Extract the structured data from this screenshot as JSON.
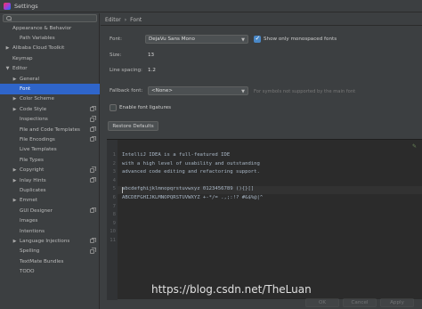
{
  "window": {
    "title": "Settings"
  },
  "sidebar": {
    "search_placeholder": "",
    "items": [
      {
        "label": "Appearance & Behavior",
        "indent": 0,
        "arrow": "",
        "selected": false,
        "copy": false
      },
      {
        "label": "Path Variables",
        "indent": 1,
        "arrow": "",
        "selected": false,
        "copy": false
      },
      {
        "label": "Alibaba Cloud Toolkit",
        "indent": 0,
        "arrow": "▶",
        "selected": false,
        "copy": false
      },
      {
        "label": "Keymap",
        "indent": 0,
        "arrow": "",
        "selected": false,
        "copy": false
      },
      {
        "label": "Editor",
        "indent": 0,
        "arrow": "▼",
        "selected": false,
        "copy": false
      },
      {
        "label": "General",
        "indent": 1,
        "arrow": "▶",
        "selected": false,
        "copy": false
      },
      {
        "label": "Font",
        "indent": 1,
        "arrow": "",
        "selected": true,
        "copy": false
      },
      {
        "label": "Color Scheme",
        "indent": 1,
        "arrow": "▶",
        "selected": false,
        "copy": false
      },
      {
        "label": "Code Style",
        "indent": 1,
        "arrow": "▶",
        "selected": false,
        "copy": true
      },
      {
        "label": "Inspections",
        "indent": 1,
        "arrow": "",
        "selected": false,
        "copy": true
      },
      {
        "label": "File and Code Templates",
        "indent": 1,
        "arrow": "",
        "selected": false,
        "copy": true
      },
      {
        "label": "File Encodings",
        "indent": 1,
        "arrow": "",
        "selected": false,
        "copy": true
      },
      {
        "label": "Live Templates",
        "indent": 1,
        "arrow": "",
        "selected": false,
        "copy": false
      },
      {
        "label": "File Types",
        "indent": 1,
        "arrow": "",
        "selected": false,
        "copy": false
      },
      {
        "label": "Copyright",
        "indent": 1,
        "arrow": "▶",
        "selected": false,
        "copy": true
      },
      {
        "label": "Inlay Hints",
        "indent": 1,
        "arrow": "▶",
        "selected": false,
        "copy": true
      },
      {
        "label": "Duplicates",
        "indent": 1,
        "arrow": "",
        "selected": false,
        "copy": false
      },
      {
        "label": "Emmet",
        "indent": 1,
        "arrow": "▶",
        "selected": false,
        "copy": false
      },
      {
        "label": "GUI Designer",
        "indent": 1,
        "arrow": "",
        "selected": false,
        "copy": true
      },
      {
        "label": "Images",
        "indent": 1,
        "arrow": "",
        "selected": false,
        "copy": false
      },
      {
        "label": "Intentions",
        "indent": 1,
        "arrow": "",
        "selected": false,
        "copy": false
      },
      {
        "label": "Language Injections",
        "indent": 1,
        "arrow": "▶",
        "selected": false,
        "copy": true
      },
      {
        "label": "Spelling",
        "indent": 1,
        "arrow": "",
        "selected": false,
        "copy": true
      },
      {
        "label": "TextMate Bundles",
        "indent": 1,
        "arrow": "",
        "selected": false,
        "copy": false
      },
      {
        "label": "TODO",
        "indent": 1,
        "arrow": "",
        "selected": false,
        "copy": false
      }
    ]
  },
  "breadcrumb": {
    "parent": "Editor",
    "separator": "›",
    "current": "Font"
  },
  "font": {
    "font_label": "Font:",
    "font_value": "DejaVu Sans Mono",
    "monospaced_label": "Show only monospaced fonts",
    "monospaced_checked": true,
    "size_label": "Size:",
    "size_value": "13",
    "spacing_label": "Line spacing:",
    "spacing_value": "1.2",
    "fallback_label": "Fallback font:",
    "fallback_value": "<None>",
    "fallback_hint": "For symbols not supported by the main font",
    "ligatures_label": "Enable font ligatures",
    "ligatures_checked": false,
    "restore_label": "Restore Defaults"
  },
  "preview": {
    "lines": [
      "IntelliJ IDEA is a full-featured IDE",
      "with a high level of usability and outstanding",
      "advanced code editing and refactoring support.",
      "",
      "abcdefghijklmnopqrstuvwxyz 0123456789 (){}[]",
      "ABCDEFGHIJKLMNOPQRSTUVWXYZ +-*/= .,;:!? #&$%@|^",
      "",
      "",
      "",
      "",
      ""
    ],
    "line_numbers": [
      "1",
      "2",
      "3",
      "4",
      "5",
      "6",
      "7",
      "8",
      "9",
      "10",
      "11"
    ]
  },
  "footer": {
    "ok_label": "OK",
    "cancel_label": "Cancel",
    "apply_label": "Apply"
  },
  "watermark": {
    "text": "https://blog.csdn.net/TheLuan"
  }
}
